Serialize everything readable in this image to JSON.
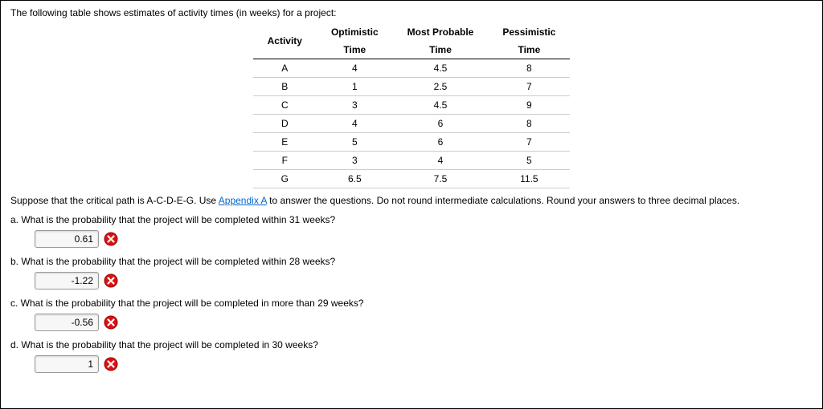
{
  "intro": "The following table shows estimates of activity times (in weeks) for a project:",
  "table": {
    "headers": {
      "activity": "Activity",
      "optimistic_l1": "Optimistic",
      "optimistic_l2": "Time",
      "probable_l1": "Most Probable",
      "probable_l2": "Time",
      "pessimistic_l1": "Pessimistic",
      "pessimistic_l2": "Time"
    },
    "rows": [
      {
        "activity": "A",
        "opt": "4",
        "prob": "4.5",
        "pess": "8"
      },
      {
        "activity": "B",
        "opt": "1",
        "prob": "2.5",
        "pess": "7"
      },
      {
        "activity": "C",
        "opt": "3",
        "prob": "4.5",
        "pess": "9"
      },
      {
        "activity": "D",
        "opt": "4",
        "prob": "6",
        "pess": "8"
      },
      {
        "activity": "E",
        "opt": "5",
        "prob": "6",
        "pess": "7"
      },
      {
        "activity": "F",
        "opt": "3",
        "prob": "4",
        "pess": "5"
      },
      {
        "activity": "G",
        "opt": "6.5",
        "prob": "7.5",
        "pess": "11.5"
      }
    ]
  },
  "suppose": {
    "pre": "Suppose that the critical path is A-C-D-E-G. Use ",
    "link": "Appendix A",
    "post": " to answer the questions. Do not round intermediate calculations. Round your answers to three decimal places."
  },
  "questions": {
    "a": {
      "text": "a. What is the probability that the project will be completed within 31 weeks?",
      "value": "0.61"
    },
    "b": {
      "text": "b. What is the probability that the project will be completed within 28 weeks?",
      "value": "-1.22"
    },
    "c": {
      "text": "c. What is the probability that the project will be completed in more than 29 weeks?",
      "value": "-0.56"
    },
    "d": {
      "text": "d. What is the probability that the project will be completed in 30 weeks?",
      "value": "1"
    }
  }
}
